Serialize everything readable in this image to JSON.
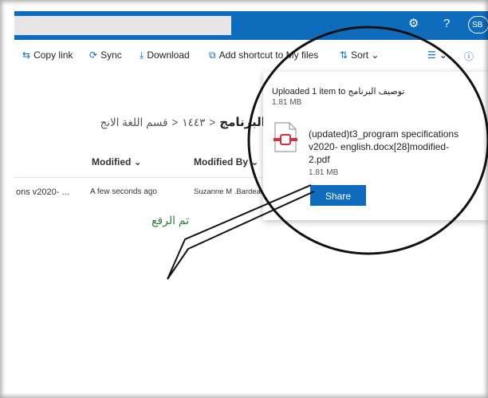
{
  "header": {
    "settings_icon": "gear-icon",
    "help_label": "?",
    "avatar_initials": "SB",
    "accent": "#0f6cbd"
  },
  "commands": {
    "copy_link": "Copy link",
    "sync": "Sync",
    "download": "Download",
    "add_shortcut": "Add shortcut to My files",
    "sort": "Sort",
    "sort_chevron": "⌄",
    "view_chevron": "⌄",
    "info_icon": "ⓘ"
  },
  "breadcrumb": {
    "items": [
      "قسم اللغة الانج",
      "١٤٤٣",
      "توصيف البرنامج"
    ],
    "separator": "<"
  },
  "columns": {
    "modified": "Modified ⌄",
    "modified_by": "Modified By ⌄"
  },
  "row": {
    "name": "ons v2020- ...",
    "modified": "A few seconds ago",
    "modified_by": "Suzanne M .Bardea"
  },
  "upload_panel": {
    "title": "Uploaded 1 item to توصيف البرنامج",
    "total_size": "1.81 MB",
    "file_name": "(updated)t3_program specifications v2020- english.docx[28]modified-2.pdf",
    "file_size": "1.81 MB",
    "share_label": "Share"
  },
  "annotation": {
    "text": "تم الرفع",
    "color": "#2e7d32"
  }
}
